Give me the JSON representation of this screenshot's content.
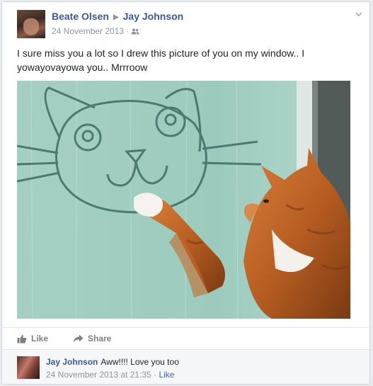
{
  "post": {
    "author": "Beate Olsen",
    "target": "Jay Johnson",
    "date": "24 November 2013",
    "date_separator": "·",
    "privacy_icon": "friends-icon",
    "text": "I sure miss you a lot so I drew this picture of you on my window.. I yowayovayowa you.. Mrrroow"
  },
  "actions": {
    "like_label": "Like",
    "share_label": "Share"
  },
  "comments": [
    {
      "author": "Jay Johnson",
      "text": "Aww!!!! Love you too",
      "timestamp": "24 November 2013 at 21:35",
      "separator": "·",
      "like_label": "Like"
    }
  ],
  "colors": {
    "name_link": "#3b5998",
    "meta_grey": "#90949c",
    "comment_bg": "#f6f7f9"
  }
}
